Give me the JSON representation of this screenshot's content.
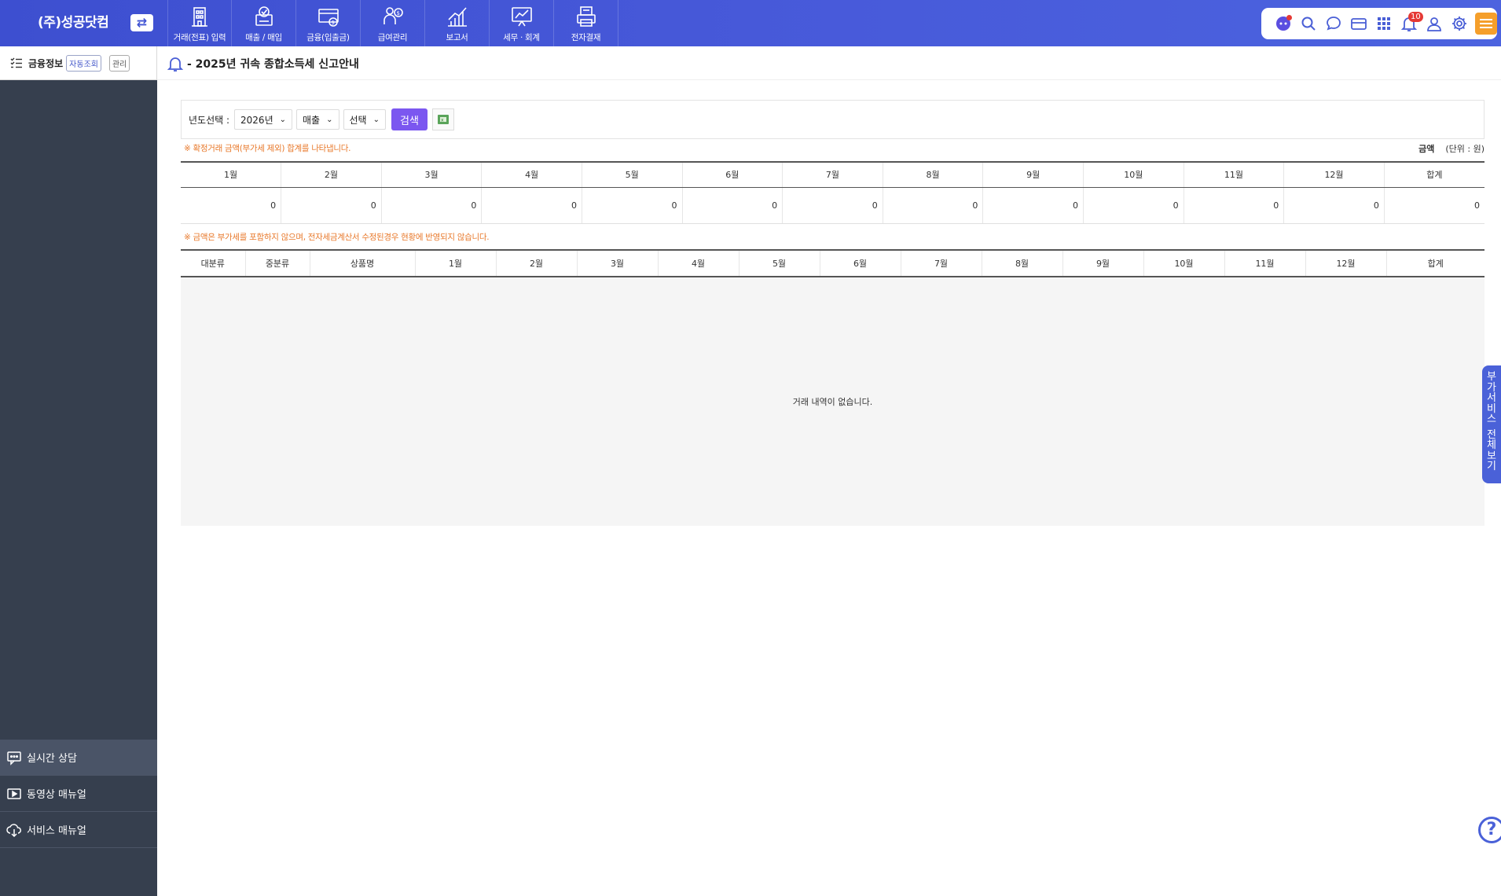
{
  "brand": "(주)성공닷컴",
  "switch_icon": "⇄",
  "menu": [
    {
      "label": "거래(전표) 입력",
      "icon": "building-icon"
    },
    {
      "label": "매출 / 매입",
      "icon": "sales-purchase-icon"
    },
    {
      "label": "금융(입출금)",
      "icon": "finance-icon"
    },
    {
      "label": "급여관리",
      "icon": "payroll-icon"
    },
    {
      "label": "보고서",
      "icon": "report-icon"
    },
    {
      "label": "세무 · 회계",
      "icon": "tax-accounting-icon"
    },
    {
      "label": "전자결재",
      "icon": "approval-icon"
    }
  ],
  "toolbar": {
    "notification_count": "10"
  },
  "sidebar": {
    "title": "금융정보",
    "chip_auto": "자동조회",
    "chip_manage": "관리",
    "links": [
      {
        "label": "실시간 상담",
        "icon": "chat-icon"
      },
      {
        "label": "동영상 매뉴얼",
        "icon": "video-icon"
      },
      {
        "label": "서비스 매뉴얼",
        "icon": "cloud-download-icon"
      }
    ]
  },
  "notice": "- 2025년 귀속 종합소득세 신고안내",
  "filter": {
    "label": "년도선택 :",
    "year": "2026년",
    "type": "매출",
    "select": "선택",
    "search": "검색"
  },
  "note1": "※ 확정거래 금액(부가세 제외) 합계를 나타냅니다.",
  "unit_label": "금액",
  "unit_value": "(단위 : 원)",
  "summary": {
    "headers": [
      "1월",
      "2월",
      "3월",
      "4월",
      "5월",
      "6월",
      "7월",
      "8월",
      "9월",
      "10월",
      "11월",
      "12월",
      "합계"
    ],
    "values": [
      "0",
      "0",
      "0",
      "0",
      "0",
      "0",
      "0",
      "0",
      "0",
      "0",
      "0",
      "0",
      "0"
    ]
  },
  "note2": "※ 금액은 부가세를 포함하지 않으며, 전자세금계산서 수정된경우 현황에 반영되지 않습니다.",
  "detail": {
    "headers": [
      "대분류",
      "중분류",
      "상품명",
      "1월",
      "2월",
      "3월",
      "4월",
      "5월",
      "6월",
      "7월",
      "8월",
      "9월",
      "10월",
      "11월",
      "12월",
      "합계"
    ]
  },
  "empty_message": "거래 내역이 없습니다.",
  "side_tab": "부가서비스 전체보기",
  "help": "?"
}
